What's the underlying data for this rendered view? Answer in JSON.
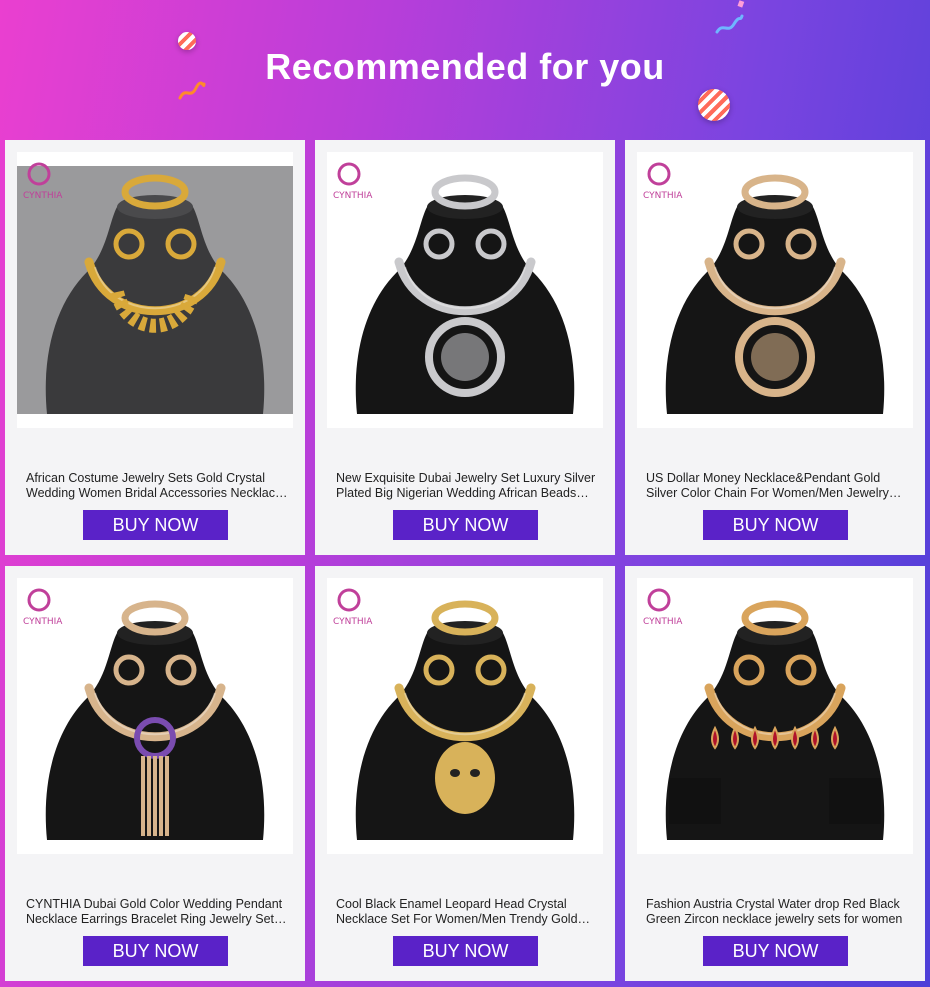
{
  "header": {
    "title": "Recommended for you"
  },
  "products": [
    {
      "name": "African Costume Jewelry Sets Gold Crystal Wedding Women Bridal Accessories Necklace Bracelet Earrings Ring Set",
      "brand": "CYNTHIA",
      "button": "BUY NOW",
      "metal": "#d9a93a",
      "motif": "filigree-set"
    },
    {
      "name": "New Exquisite Dubai Jewelry Set Luxury Silver Plated Big Nigerian Wedding African Beads Jewelry Set Costume",
      "brand": "CYNTHIA",
      "button": "BUY NOW",
      "metal": "#c9c9cc",
      "motif": "swirl-pendant"
    },
    {
      "name": "US Dollar Money Necklace&Pendant Gold Silver Color Chain For Women/Men Jewelry Set",
      "brand": "CYNTHIA",
      "button": "BUY NOW",
      "metal": "#d8b48a",
      "motif": "dollar-pendant"
    },
    {
      "name": "CYNTHIA Dubai Gold Color Wedding Pendant Necklace Earrings Bracelet Ring Jewelry Set For Women",
      "brand": "CYNTHIA",
      "button": "BUY NOW",
      "metal": "#d7b48c",
      "motif": "tassel-pendant"
    },
    {
      "name": "Cool Black Enamel Leopard Head Crystal Necklace Set For Women/Men Trendy Gold Color Jewelry Set",
      "brand": "CYNTHIA",
      "button": "BUY NOW",
      "metal": "#d8b25a",
      "motif": "leopard-pendant"
    },
    {
      "name": "Fashion Austria Crystal Water drop Red Black Green Zircon necklace jewelry sets for women",
      "brand": "CYNTHIA",
      "button": "BUY NOW",
      "metal": "#d9a45c",
      "motif": "red-teardrop"
    }
  ]
}
